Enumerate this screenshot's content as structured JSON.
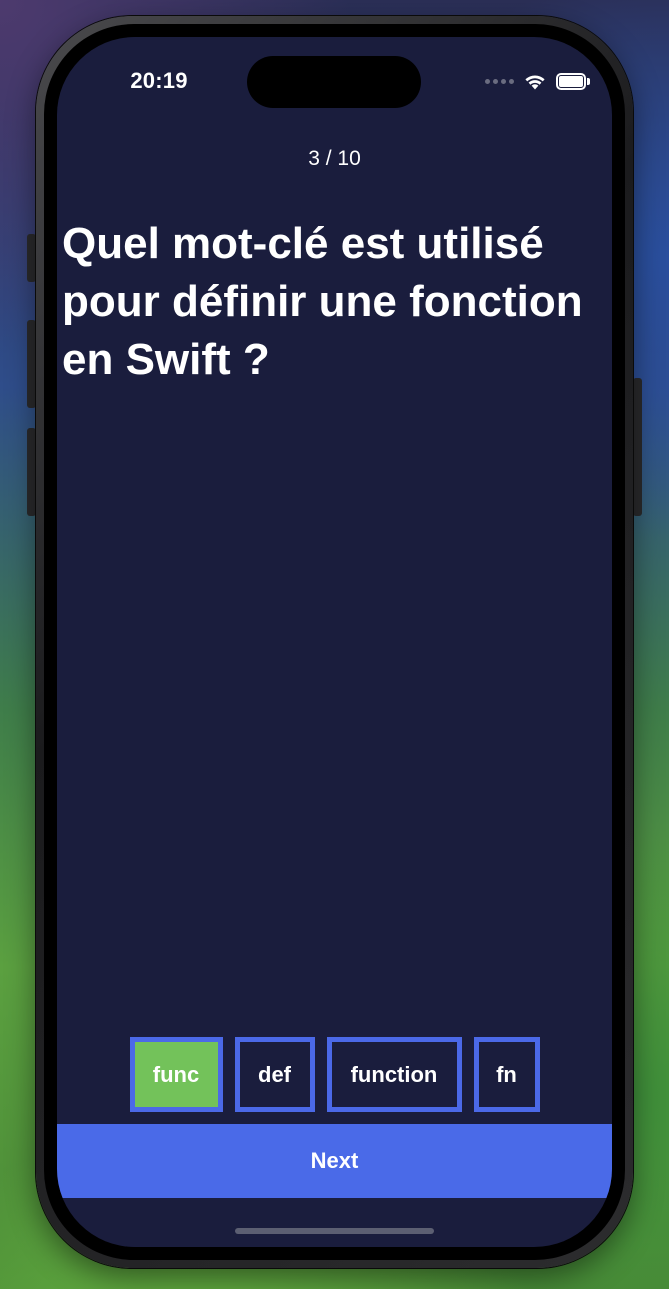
{
  "status_bar": {
    "time": "20:19",
    "wifi_icon": "wifi-icon",
    "battery_icon": "battery-icon",
    "signal_icon": "cellular-signal-icon"
  },
  "quiz": {
    "progress": "3 / 10",
    "question": "Quel mot-clé est utilisé pour définir une fonction en Swift ?",
    "answers": [
      {
        "label": "func",
        "selected": true
      },
      {
        "label": "def",
        "selected": false
      },
      {
        "label": "function",
        "selected": false
      },
      {
        "label": "fn",
        "selected": false
      }
    ],
    "next_label": "Next"
  },
  "colors": {
    "background": "#1a1d3d",
    "accent": "#4a6ae8",
    "selected_answer": "#73c25a",
    "text": "#ffffff"
  }
}
